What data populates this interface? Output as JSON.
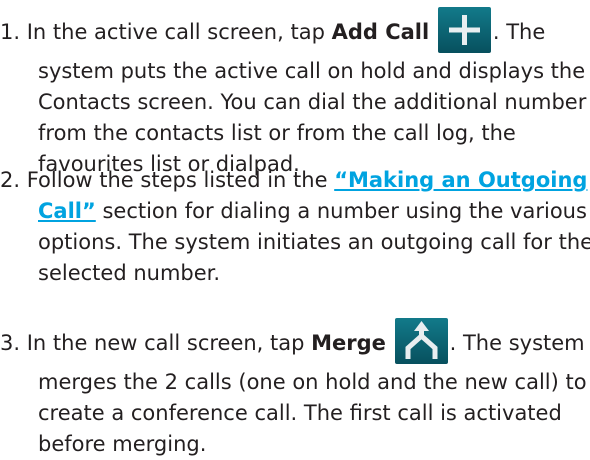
{
  "steps": [
    {
      "number": "1.",
      "lines": [
        {
          "before": " In the active call screen, tap ",
          "bold": "Add Call",
          "after": ". The"
        },
        "system puts the active call on hold and displays the",
        "Contacts screen. You can dial the additional number",
        "from the contacts list or from the call log, the",
        "favourites list or dialpad."
      ],
      "icon": "add-call-icon"
    },
    {
      "number": "2.",
      "lines": [
        {
          "before": " Follow the steps listed in the ",
          "link": "“Making an Outgoing"
        },
        {
          "link": "Call”",
          "after": " section for dialing a number using the various"
        },
        "options. The system initiates an outgoing call for the",
        "selected number."
      ]
    },
    {
      "number": "3.",
      "lines": [
        {
          "before": " In the new call screen, tap ",
          "bold": "Merge",
          "after": ". The system"
        },
        "merges the 2 calls (one on hold and the new call) to",
        "create a conference call. The first call is activated",
        "before merging."
      ],
      "icon": "merge-calls-icon"
    }
  ],
  "colors": {
    "text": "#231f20",
    "link": "#00a3e0",
    "icon_bg": "#0a6a7a",
    "icon_glyph": "#e8eef0"
  }
}
